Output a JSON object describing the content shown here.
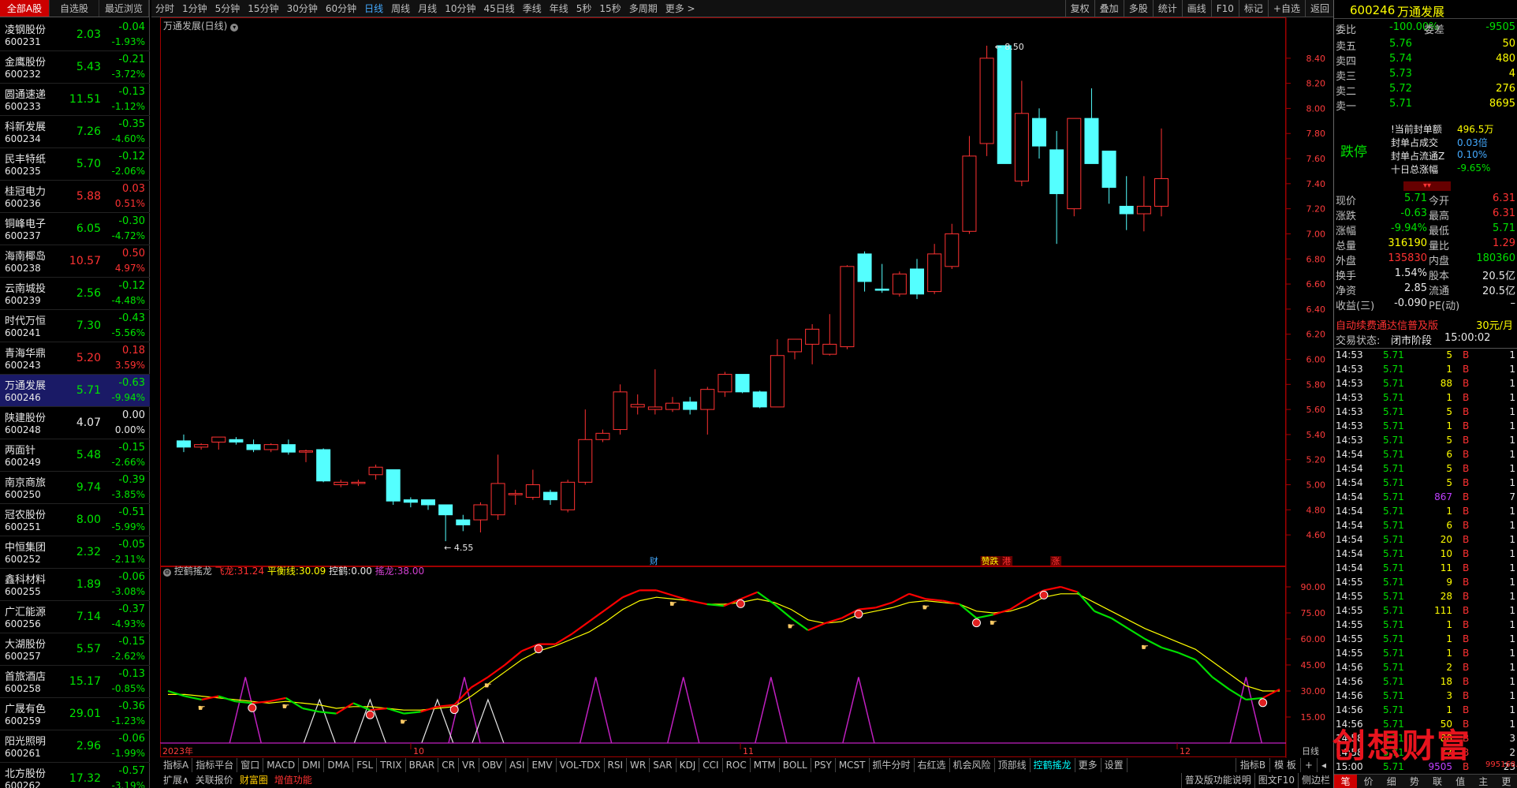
{
  "list_tabs": [
    "全部A股",
    "自选股",
    "最近浏览"
  ],
  "stocks": [
    {
      "name": "凌钢股份",
      "code": "600231",
      "price": "2.03",
      "change": "-0.04",
      "pct": "-1.93%",
      "dir": "dn"
    },
    {
      "name": "金鹰股份",
      "code": "600232",
      "price": "5.43",
      "change": "-0.21",
      "pct": "-3.72%",
      "dir": "dn"
    },
    {
      "name": "圆通速递",
      "code": "600233",
      "price": "11.51",
      "change": "-0.13",
      "pct": "-1.12%",
      "dir": "dn"
    },
    {
      "name": "科新发展",
      "code": "600234",
      "price": "7.26",
      "change": "-0.35",
      "pct": "-4.60%",
      "dir": "dn"
    },
    {
      "name": "民丰特纸",
      "code": "600235",
      "price": "5.70",
      "change": "-0.12",
      "pct": "-2.06%",
      "dir": "dn"
    },
    {
      "name": "桂冠电力",
      "code": "600236",
      "price": "5.88",
      "change": "0.03",
      "pct": "0.51%",
      "dir": "up"
    },
    {
      "name": "铜峰电子",
      "code": "600237",
      "price": "6.05",
      "change": "-0.30",
      "pct": "-4.72%",
      "dir": "dn"
    },
    {
      "name": "海南椰岛",
      "code": "600238",
      "price": "10.57",
      "change": "0.50",
      "pct": "4.97%",
      "dir": "up"
    },
    {
      "name": "云南城投",
      "code": "600239",
      "price": "2.56",
      "change": "-0.12",
      "pct": "-4.48%",
      "dir": "dn"
    },
    {
      "name": "时代万恒",
      "code": "600241",
      "price": "7.30",
      "change": "-0.43",
      "pct": "-5.56%",
      "dir": "dn"
    },
    {
      "name": "青海华鼎",
      "code": "600243",
      "price": "5.20",
      "change": "0.18",
      "pct": "3.59%",
      "dir": "up"
    },
    {
      "name": "万通发展",
      "code": "600246",
      "price": "5.71",
      "change": "-0.63",
      "pct": "-9.94%",
      "dir": "dn"
    },
    {
      "name": "陕建股份",
      "code": "600248",
      "price": "4.07",
      "change": "0.00",
      "pct": "0.00%",
      "dir": "eq"
    },
    {
      "name": "两面针",
      "code": "600249",
      "price": "5.48",
      "change": "-0.15",
      "pct": "-2.66%",
      "dir": "dn"
    },
    {
      "name": "南京商旅",
      "code": "600250",
      "price": "9.74",
      "change": "-0.39",
      "pct": "-3.85%",
      "dir": "dn"
    },
    {
      "name": "冠农股份",
      "code": "600251",
      "price": "8.00",
      "change": "-0.51",
      "pct": "-5.99%",
      "dir": "dn"
    },
    {
      "name": "中恒集团",
      "code": "600252",
      "price": "2.32",
      "change": "-0.05",
      "pct": "-2.11%",
      "dir": "dn"
    },
    {
      "name": "鑫科材料",
      "code": "600255",
      "price": "1.89",
      "change": "-0.06",
      "pct": "-3.08%",
      "dir": "dn"
    },
    {
      "name": "广汇能源",
      "code": "600256",
      "price": "7.14",
      "change": "-0.37",
      "pct": "-4.93%",
      "dir": "dn"
    },
    {
      "name": "大湖股份",
      "code": "600257",
      "price": "5.57",
      "change": "-0.15",
      "pct": "-2.62%",
      "dir": "dn"
    },
    {
      "name": "首旅酒店",
      "code": "600258",
      "price": "15.17",
      "change": "-0.13",
      "pct": "-0.85%",
      "dir": "dn"
    },
    {
      "name": "广晟有色",
      "code": "600259",
      "price": "29.01",
      "change": "-0.36",
      "pct": "-1.23%",
      "dir": "dn"
    },
    {
      "name": "阳光照明",
      "code": "600261",
      "price": "2.96",
      "change": "-0.06",
      "pct": "-1.99%",
      "dir": "dn"
    },
    {
      "name": "北方股份",
      "code": "600262",
      "price": "17.32",
      "change": "-0.57",
      "pct": "-3.19%",
      "dir": "dn"
    }
  ],
  "periods": [
    "分时",
    "1分钟",
    "5分钟",
    "15分钟",
    "30分钟",
    "60分钟",
    "日线",
    "周线",
    "月线",
    "10分钟",
    "45日线",
    "季线",
    "年线",
    "5秒",
    "15秒",
    "多周期",
    "更多 >"
  ],
  "active_period": "日线",
  "tools_right": [
    "复权",
    "叠加",
    "多股",
    "统计",
    "画线",
    "F10",
    "标记",
    "+自选",
    "返回"
  ],
  "chart_title": "万通发展(日线)",
  "indicator": {
    "name": "控鹤搖龙",
    "fly_label": "飞龙:",
    "fly_val": "31.24",
    "bal_label": "平衡线:",
    "bal_val": "30.09",
    "ctrl_label": "控鹤:",
    "ctrl_val": "0.00",
    "swing_label": "搖龙:",
    "swing_val": "38.00"
  },
  "chart_data": {
    "type": "candlestick",
    "price_ticks": [
      "8.40",
      "8.20",
      "8.00",
      "7.80",
      "7.60",
      "7.40",
      "7.20",
      "7.00",
      "6.80",
      "6.60",
      "6.40",
      "6.20",
      "6.00",
      "5.80",
      "5.60",
      "5.40",
      "5.20",
      "5.00",
      "4.80",
      "4.60"
    ],
    "ind_ticks": [
      "90.00",
      "75.00",
      "60.00",
      "45.00",
      "30.00",
      "15.00"
    ],
    "x_labels": [
      "2023年",
      "10",
      "11",
      "12"
    ],
    "high_label": "8.50",
    "low_label": "4.55",
    "markers": [
      "财",
      "赞跌",
      "港",
      "涨"
    ],
    "candles": [
      [
        5.35,
        5.3,
        5.4,
        5.26
      ],
      [
        5.3,
        5.32,
        5.33,
        5.28
      ],
      [
        5.34,
        5.38,
        5.38,
        5.28
      ],
      [
        5.36,
        5.34,
        5.38,
        5.32
      ],
      [
        5.32,
        5.28,
        5.36,
        5.26
      ],
      [
        5.28,
        5.32,
        5.33,
        5.26
      ],
      [
        5.32,
        5.26,
        5.36,
        5.24
      ],
      [
        5.26,
        5.27,
        5.28,
        5.18
      ],
      [
        5.28,
        5.03,
        5.29,
        5.02
      ],
      [
        5.0,
        5.02,
        5.04,
        4.98
      ],
      [
        5.01,
        5.02,
        5.04,
        4.99
      ],
      [
        5.08,
        5.14,
        5.16,
        5.04
      ],
      [
        5.12,
        4.87,
        5.12,
        4.84
      ],
      [
        4.88,
        4.86,
        4.9,
        4.82
      ],
      [
        4.88,
        4.84,
        4.88,
        4.8
      ],
      [
        4.84,
        4.76,
        4.84,
        4.55
      ],
      [
        4.72,
        4.68,
        4.76,
        4.63
      ],
      [
        4.72,
        4.84,
        4.86,
        4.62
      ],
      [
        4.76,
        5.01,
        5.24,
        4.72
      ],
      [
        4.92,
        4.93,
        4.96,
        4.84
      ],
      [
        4.9,
        5.0,
        5.12,
        4.88
      ],
      [
        4.94,
        4.88,
        4.96,
        4.84
      ],
      [
        4.8,
        5.02,
        5.04,
        4.78
      ],
      [
        5.02,
        5.36,
        5.6,
        5.0
      ],
      [
        5.36,
        5.41,
        5.44,
        5.34
      ],
      [
        5.44,
        5.74,
        5.8,
        5.4
      ],
      [
        5.62,
        5.64,
        5.72,
        5.56
      ],
      [
        5.6,
        5.62,
        5.92,
        5.56
      ],
      [
        5.6,
        5.65,
        5.7,
        5.58
      ],
      [
        5.66,
        5.6,
        5.7,
        5.56
      ],
      [
        5.6,
        5.76,
        5.78,
        5.4
      ],
      [
        5.74,
        5.88,
        5.9,
        5.7
      ],
      [
        5.88,
        5.74,
        5.88,
        5.73
      ],
      [
        5.74,
        5.62,
        5.75,
        5.61
      ],
      [
        5.62,
        6.03,
        6.16,
        5.62
      ],
      [
        6.06,
        6.16,
        6.16,
        6.0
      ],
      [
        6.12,
        6.24,
        6.28,
        5.96
      ],
      [
        6.04,
        6.12,
        6.36,
        6.03
      ],
      [
        6.1,
        6.74,
        6.75,
        6.08
      ],
      [
        6.84,
        6.62,
        6.86,
        6.54
      ],
      [
        6.56,
        6.55,
        6.76,
        6.53
      ],
      [
        6.52,
        6.68,
        6.7,
        6.5
      ],
      [
        6.72,
        6.52,
        6.8,
        6.48
      ],
      [
        6.54,
        6.84,
        6.92,
        6.52
      ],
      [
        6.74,
        7.0,
        7.08,
        6.72
      ],
      [
        7.02,
        7.62,
        7.78,
        7.0
      ],
      [
        7.72,
        8.4,
        8.5,
        7.62
      ],
      [
        8.5,
        7.56,
        8.5,
        7.56
      ],
      [
        7.42,
        7.96,
        8.22,
        7.38
      ],
      [
        7.92,
        7.7,
        8.0,
        7.6
      ],
      [
        7.67,
        7.32,
        7.82,
        6.92
      ],
      [
        7.2,
        7.92,
        7.92,
        7.14
      ],
      [
        7.92,
        7.56,
        8.16,
        7.56
      ],
      [
        7.66,
        7.37,
        7.66,
        7.24
      ],
      [
        7.22,
        7.16,
        7.46,
        7.03
      ],
      [
        7.16,
        7.22,
        7.46,
        7.02
      ],
      [
        7.22,
        7.44,
        7.84,
        7.14
      ]
    ],
    "fly": [
      30,
      27,
      25,
      27,
      24,
      23,
      24,
      26,
      20,
      18,
      17,
      23,
      19,
      20,
      17,
      18,
      21,
      22,
      32,
      38,
      45,
      53,
      57,
      57,
      63,
      70,
      77,
      84,
      88,
      88,
      85,
      82,
      80,
      79,
      83,
      87,
      80,
      72,
      65,
      69,
      72,
      77,
      78,
      81,
      86,
      83,
      82,
      80,
      72,
      74,
      77,
      83,
      88,
      90,
      87,
      76,
      72,
      66,
      60,
      55,
      52,
      48,
      38,
      31,
      25,
      26,
      31
    ],
    "bal": [
      28,
      28,
      27,
      26,
      25,
      24,
      23,
      24,
      23,
      22,
      20,
      21,
      21,
      20,
      19,
      19,
      20,
      21,
      27,
      34,
      41,
      48,
      53,
      56,
      60,
      64,
      70,
      77,
      82,
      84,
      83,
      82,
      80,
      80,
      81,
      83,
      81,
      77,
      71,
      69,
      70,
      74,
      76,
      78,
      81,
      82,
      81,
      80,
      76,
      75,
      76,
      79,
      84,
      86,
      86,
      81,
      76,
      71,
      66,
      62,
      58,
      54,
      47,
      40,
      33,
      30,
      30
    ],
    "swing_spikes": [
      [
        1,
        38
      ],
      [
        6,
        38
      ],
      [
        9,
        38
      ],
      [
        11,
        38
      ],
      [
        13,
        38
      ],
      [
        15,
        38
      ],
      [
        62,
        38
      ]
    ]
  },
  "bottom_tabs": [
    "指标A",
    "指标平台",
    "窗口",
    "MACD",
    "DMI",
    "DMA",
    "FSL",
    "TRIX",
    "BRAR",
    "CR",
    "VR",
    "OBV",
    "ASI",
    "EMV",
    "VOL-TDX",
    "RSI",
    "WR",
    "SAR",
    "KDJ",
    "CCI",
    "ROC",
    "MTM",
    "BOLL",
    "PSY",
    "MCST",
    "抓牛分时",
    "右红选",
    "机会风险",
    "顶部线",
    "控鹤搖龙",
    "更多",
    "设置"
  ],
  "bottom_right_tabs": [
    "指标B",
    "模 板",
    "+",
    "◂"
  ],
  "bottom2": [
    "扩展∧",
    "关联报价",
    "财富圈",
    "增值功能"
  ],
  "bottom2_right": [
    "普及版功能说明",
    "图文F10",
    "侧边栏"
  ],
  "rp": {
    "code": "600246",
    "name": "万通发展",
    "wb_label": "委比",
    "wb_val": "-100.00%",
    "wc_label": "委差",
    "wc_val": "-9505",
    "asks": [
      {
        "l": "卖五",
        "p": "5.76",
        "v": "50"
      },
      {
        "l": "卖四",
        "p": "5.74",
        "v": "480"
      },
      {
        "l": "卖三",
        "p": "5.73",
        "v": "4"
      },
      {
        "l": "卖二",
        "p": "5.72",
        "v": "276"
      },
      {
        "l": "卖一",
        "p": "5.71",
        "v": "8695"
      }
    ],
    "limit_status": "跌停",
    "seal": [
      {
        "l": "!当前封单额",
        "v": "496.5万"
      },
      {
        "l": "封单占成交",
        "v": "0.03倍"
      },
      {
        "l": "封单占流通Z",
        "v": "0.10%"
      },
      {
        "l": "十日总涨幅",
        "v": "-9.65%"
      }
    ],
    "quote": [
      {
        "a": "现价",
        "av": "5.71",
        "b": "今开",
        "bv": "6.31"
      },
      {
        "a": "涨跌",
        "av": "-0.63",
        "b": "最高",
        "bv": "6.31"
      },
      {
        "a": "涨幅",
        "av": "-9.94%",
        "b": "最低",
        "bv": "5.71"
      },
      {
        "a": "总量",
        "av": "316190",
        "b": "量比",
        "bv": "1.29"
      },
      {
        "a": "外盘",
        "av": "135830",
        "b": "内盘",
        "bv": "180360"
      },
      {
        "a": "换手",
        "av": "1.54%",
        "b": "股本",
        "bv": "20.5亿"
      },
      {
        "a": "净资",
        "av": "2.85",
        "b": "流通",
        "bv": "20.5亿"
      },
      {
        "a": "收益(三)",
        "av": "-0.090",
        "b": "PE(动)",
        "bv": "–"
      }
    ],
    "promo": "自动续费通达信普及版",
    "promo_price": "30元/月",
    "state": "交易状态:",
    "state_val": "闭市阶段",
    "state_time": "15:00:02",
    "ticks": [
      [
        "14:53",
        "5.71",
        "5",
        "B",
        "1"
      ],
      [
        "14:53",
        "5.71",
        "1",
        "B",
        "1"
      ],
      [
        "14:53",
        "5.71",
        "88",
        "B",
        "1"
      ],
      [
        "14:53",
        "5.71",
        "1",
        "B",
        "1"
      ],
      [
        "14:53",
        "5.71",
        "5",
        "B",
        "1"
      ],
      [
        "14:53",
        "5.71",
        "1",
        "B",
        "1"
      ],
      [
        "14:53",
        "5.71",
        "5",
        "B",
        "1"
      ],
      [
        "14:54",
        "5.71",
        "6",
        "B",
        "1"
      ],
      [
        "14:54",
        "5.71",
        "5",
        "B",
        "1"
      ],
      [
        "14:54",
        "5.71",
        "5",
        "B",
        "1"
      ],
      [
        "14:54",
        "5.71",
        "867",
        "B",
        "7"
      ],
      [
        "14:54",
        "5.71",
        "1",
        "B",
        "1"
      ],
      [
        "14:54",
        "5.71",
        "6",
        "B",
        "1"
      ],
      [
        "14:54",
        "5.71",
        "20",
        "B",
        "1"
      ],
      [
        "14:54",
        "5.71",
        "10",
        "B",
        "1"
      ],
      [
        "14:54",
        "5.71",
        "11",
        "B",
        "1"
      ],
      [
        "14:55",
        "5.71",
        "9",
        "B",
        "1"
      ],
      [
        "14:55",
        "5.71",
        "28",
        "B",
        "1"
      ],
      [
        "14:55",
        "5.71",
        "111",
        "B",
        "1"
      ],
      [
        "14:55",
        "5.71",
        "1",
        "B",
        "1"
      ],
      [
        "14:55",
        "5.71",
        "1",
        "B",
        "1"
      ],
      [
        "14:55",
        "5.71",
        "1",
        "B",
        "1"
      ],
      [
        "14:56",
        "5.71",
        "2",
        "B",
        "1"
      ],
      [
        "14:56",
        "5.71",
        "18",
        "B",
        "1"
      ],
      [
        "14:56",
        "5.71",
        "3",
        "B",
        "1"
      ],
      [
        "14:56",
        "5.71",
        "1",
        "B",
        "1"
      ],
      [
        "14:56",
        "5.71",
        "50",
        "B",
        "1"
      ],
      [
        "14:58",
        "5.71",
        "88",
        "B",
        "3"
      ],
      [
        "14:58",
        "5.71",
        "77",
        "B",
        "2"
      ],
      [
        "15:00",
        "5.71",
        "9505",
        "B",
        "23"
      ]
    ],
    "bottom_tabs": [
      "笔",
      "价",
      "细",
      "势",
      "联",
      "值",
      "主",
      "更"
    ]
  },
  "watermark": "创想财富",
  "watermark_url": "995168.cn",
  "colors": {
    "up": "#ff3232",
    "down": "#54ffff",
    "fly": "#ff0000",
    "bal": "#ffff00",
    "swing": "#c020c0",
    "axis": "#a00000"
  }
}
